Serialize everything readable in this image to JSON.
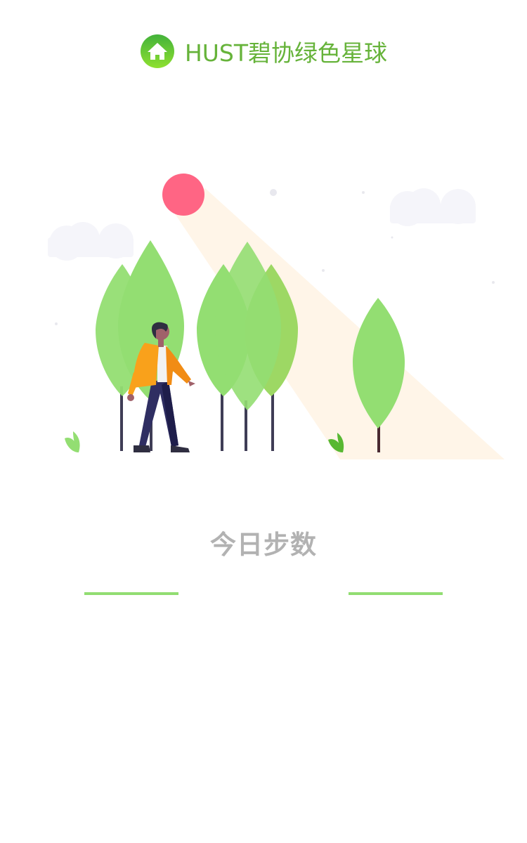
{
  "header": {
    "title": "HUST碧协绿色星球",
    "logo_icon": "home-icon"
  },
  "illustration": {
    "description_icon": "walking-person-in-forest-illustration"
  },
  "steps": {
    "title": "今日步数"
  },
  "colors": {
    "brand_green": "#66b33a",
    "tree_green": "#93de72",
    "sun_pink": "#ff6584",
    "muted_text": "#b2b2b2"
  }
}
